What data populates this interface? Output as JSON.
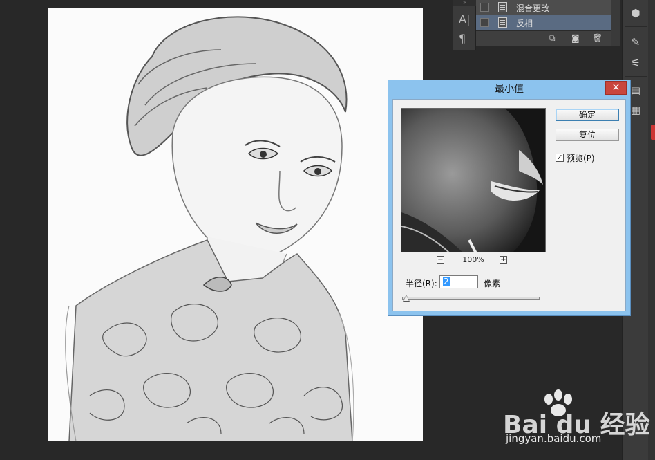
{
  "history_panel": {
    "items": [
      {
        "label": "混合更改",
        "selected": false
      },
      {
        "label": "反相",
        "selected": true
      }
    ],
    "tools": [
      "type-tool-icon",
      "paragraph-icon"
    ],
    "bottom_icons": [
      "new-document-icon",
      "snapshot-icon",
      "trash-icon"
    ]
  },
  "dialog": {
    "title": "最小值",
    "close_label": "✕",
    "ok_label": "确定",
    "reset_label": "复位",
    "preview_checkbox": {
      "label": "预览(P)",
      "checked": true
    },
    "zoom": {
      "value": "100%",
      "minus": "−",
      "plus": "+"
    },
    "radius": {
      "label": "半径(R):",
      "value": "2",
      "unit": "像素"
    }
  },
  "watermark": {
    "brand": "Bai du 经验",
    "url": "jingyan.baidu.com"
  },
  "colors": {
    "dialog_frame": "#8cc3ee",
    "close_button": "#c9463d",
    "workspace": "#282828",
    "panel": "#4d4d4d",
    "selected_row": "#5a6b82"
  }
}
